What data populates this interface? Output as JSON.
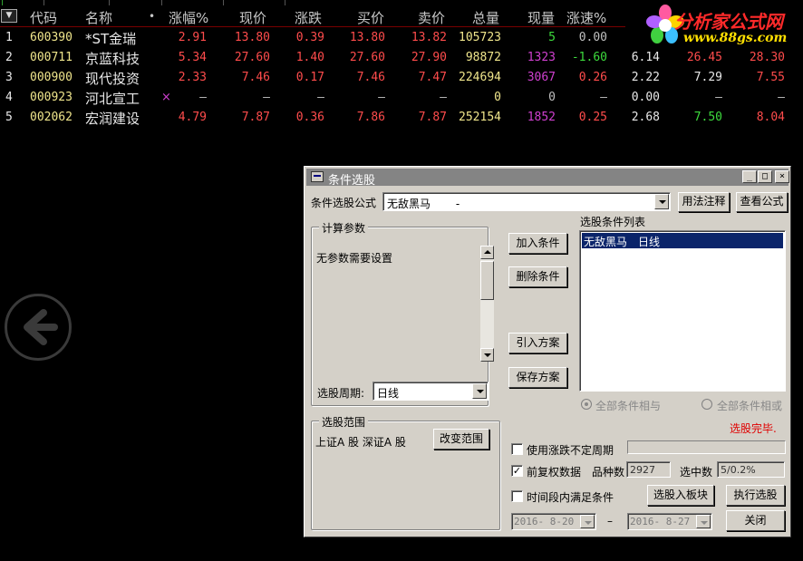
{
  "table": {
    "columns": [
      "代码",
      "名称",
      "•",
      "涨幅%",
      "现价",
      "涨跌",
      "买价",
      "卖价",
      "总量",
      "现量",
      "涨速%"
    ],
    "rows": [
      {
        "idx": "1",
        "code": "600390",
        "name": "*ST金瑞",
        "mark": "",
        "pct": "2.91",
        "price": "13.80",
        "change": "0.39",
        "bid": "13.80",
        "ask": "13.82",
        "vol": "105723",
        "cur": "5",
        "speed": "0.00",
        "x1": "",
        "x2": "",
        "x3": ""
      },
      {
        "idx": "2",
        "code": "000711",
        "name": "京蓝科技",
        "mark": "",
        "pct": "5.34",
        "price": "27.60",
        "change": "1.40",
        "bid": "27.60",
        "ask": "27.90",
        "vol": "98872",
        "cur": "1323",
        "speed": "-1.60",
        "x1": "6.14",
        "x2": "26.45",
        "x3": "28.30"
      },
      {
        "idx": "3",
        "code": "000900",
        "name": "现代投资",
        "mark": "",
        "pct": "2.33",
        "price": "7.46",
        "change": "0.17",
        "bid": "7.46",
        "ask": "7.47",
        "vol": "224694",
        "cur": "3067",
        "speed": "0.26",
        "x1": "2.22",
        "x2": "7.29",
        "x3": "7.55"
      },
      {
        "idx": "4",
        "code": "000923",
        "name": "河北宣工",
        "mark": "×",
        "pct": "–",
        "price": "–",
        "change": "–",
        "bid": "–",
        "ask": "–",
        "vol": "0",
        "cur": "0",
        "speed": "–",
        "x1": "0.00",
        "x2": "–",
        "x3": "–"
      },
      {
        "idx": "5",
        "code": "002062",
        "name": "宏润建设",
        "mark": "",
        "pct": "4.79",
        "price": "7.87",
        "change": "0.36",
        "bid": "7.86",
        "ask": "7.87",
        "vol": "252154",
        "cur": "1852",
        "speed": "0.25",
        "x1": "2.68",
        "x2": "7.50",
        "x3": "8.04"
      }
    ]
  },
  "logo": {
    "title": "分析家公式网",
    "url": "www.88gs.com"
  },
  "dialog": {
    "title": "条件选股",
    "formula_label": "条件选股公式",
    "formula_value": "无敌黑马　　 -",
    "usage_button": "用法注释",
    "view_formula_button": "查看公式",
    "params_group": "计算参数",
    "params_text": "无参数需要设置",
    "period_label": "选股周期:",
    "period_value": "日线",
    "add_button": "加入条件",
    "delete_button": "删除条件",
    "import_button": "引入方案",
    "save_button": "保存方案",
    "condition_list_label": "选股条件列表",
    "conditions": [
      "无敌黑马　日线"
    ],
    "radio_and": "全部条件相与",
    "radio_or": "全部条件相或",
    "status": "选股完毕.",
    "scope_group": "选股范围",
    "scope_text": "上证A 股  深证A 股",
    "change_scope_button": "改变范围",
    "chk_uncertain": "使用涨跌不定周期",
    "chk_prior_rights": "前复权数据",
    "chk_period_cond": "时间段内满足条件",
    "count_label": "品种数",
    "count_value": "2927",
    "selected_label": "选中数",
    "selected_value": "5/0.2%",
    "date_from": "2016- 8-20",
    "date_sep": "–",
    "date_to": "2016- 8-27",
    "to_board_button": "选股入板块",
    "execute_button": "执行选股",
    "close_button": "关闭"
  },
  "colors": {
    "up": "#ff4c4c",
    "down": "#3ddc3d",
    "code": "#f0e68c",
    "volume": "#d040d0"
  }
}
